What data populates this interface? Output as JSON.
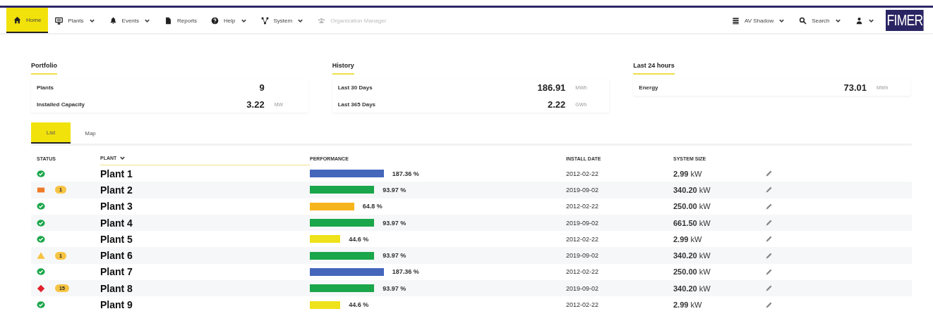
{
  "nav": {
    "items": [
      {
        "label": "Home",
        "selected": true,
        "dropdown": false,
        "disabled": false
      },
      {
        "label": "Plants",
        "selected": false,
        "dropdown": true,
        "disabled": false
      },
      {
        "label": "Events",
        "selected": false,
        "dropdown": true,
        "disabled": false
      },
      {
        "label": "Reports",
        "selected": false,
        "dropdown": false,
        "disabled": false
      },
      {
        "label": "Help",
        "selected": false,
        "dropdown": true,
        "disabled": false
      },
      {
        "label": "System",
        "selected": false,
        "dropdown": true,
        "disabled": false
      },
      {
        "label": "Organization Manager",
        "selected": false,
        "dropdown": false,
        "disabled": true
      }
    ],
    "right": [
      {
        "label": "AV Shadow"
      },
      {
        "label": "Search"
      }
    ],
    "logo": "FIMER"
  },
  "sections": [
    {
      "title": "Portfolio",
      "rows": [
        {
          "label": "Plants",
          "value": "9",
          "unit": ""
        },
        {
          "label": "Installed Capacity",
          "value": "3.22",
          "unit": "MW"
        }
      ]
    },
    {
      "title": "History",
      "rows": [
        {
          "label": "Last 30 Days",
          "value": "186.91",
          "unit": "MWh"
        },
        {
          "label": "Last 365 Days",
          "value": "2.22",
          "unit": "GWh"
        }
      ]
    },
    {
      "title": "Last 24 hours",
      "rows": [
        {
          "label": "Energy",
          "value": "73.01",
          "unit": "MWh"
        }
      ]
    }
  ],
  "tabs": [
    {
      "label": "List",
      "selected": true
    },
    {
      "label": "Map",
      "selected": false
    }
  ],
  "table": {
    "columns": [
      "STATUS",
      "PLANT",
      "PERFORMANCE",
      "INSTALL DATE",
      "SYSTEM SIZE"
    ],
    "rows": [
      {
        "kind": "ok",
        "plant": "Plant 1",
        "color": "#4466bb",
        "performance": "187.36 %",
        "date": "2012-02-22",
        "size": "2.99",
        "unit": "kW"
      },
      {
        "kind": "fault",
        "count": "1",
        "plant": "Plant 2",
        "color": "#1aa64a",
        "performance": "93.97 %",
        "date": "2019-09-02",
        "size": "340.20",
        "unit": "kW"
      },
      {
        "kind": "ok",
        "plant": "Plant 3",
        "color": "#f6b51c",
        "performance": "64.8 %",
        "date": "2012-02-22",
        "size": "250.00",
        "unit": "kW"
      },
      {
        "kind": "ok",
        "plant": "Plant 4",
        "color": "#1aa64a",
        "performance": "93.97 %",
        "date": "2019-09-02",
        "size": "661.50",
        "unit": "kW"
      },
      {
        "kind": "ok",
        "plant": "Plant 5",
        "color": "#eee21a",
        "performance": "44.6 %",
        "date": "2012-02-22",
        "size": "2.99",
        "unit": "kW"
      },
      {
        "kind": "warning",
        "count": "1",
        "plant": "Plant 6",
        "color": "#1aa64a",
        "performance": "93.97 %",
        "date": "2019-09-02",
        "size": "340.20",
        "unit": "kW"
      },
      {
        "kind": "ok",
        "plant": "Plant 7",
        "color": "#4466bb",
        "performance": "187.36 %",
        "date": "2012-02-22",
        "size": "250.00",
        "unit": "kW"
      },
      {
        "kind": "critical",
        "count": "15",
        "plant": "Plant 8",
        "color": "#1aa64a",
        "performance": "93.97 %",
        "date": "2019-09-02",
        "size": "340.20",
        "unit": "kW"
      },
      {
        "kind": "ok",
        "plant": "Plant 9",
        "color": "#eee21a",
        "performance": "44.6 %",
        "date": "2012-02-22",
        "size": "2.99",
        "unit": "kW"
      }
    ]
  }
}
